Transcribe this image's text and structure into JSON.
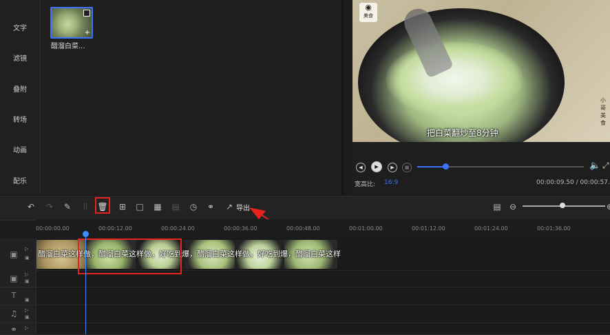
{
  "sidebar": {
    "items": [
      {
        "label": "文字"
      },
      {
        "label": "滤镜"
      },
      {
        "label": "叠附"
      },
      {
        "label": "转场"
      },
      {
        "label": "动画"
      },
      {
        "label": "配乐"
      }
    ]
  },
  "media": {
    "clip_label": "醋溜白菜..."
  },
  "preview": {
    "subtitle": "把白菜翻炒至8分钟",
    "logo_text": "美食",
    "vertical_text": "小哥美食",
    "aspect_label": "宽高比:",
    "aspect_value": "16:9",
    "time": "00:00:09.50 / 00:00:57.7",
    "progress_fraction": 0.17
  },
  "toolbar": {
    "export_label": "导出",
    "delete_tooltip": "删除",
    "zoom_fraction": 0.48
  },
  "timeline": {
    "ruler": [
      "00:00:00.00",
      "00:00:12.00",
      "00:00:24.00",
      "00:00:36.00",
      "00:00:48.00",
      "00:01:00.00",
      "00:01:12.00",
      "00:01:24.00",
      "00:01:36.00"
    ],
    "clip_text": "醋溜白菜这样做，醋溜白菜这样做，好吃到爆，醋溜白菜这样做，好吃到爆，醋溜白菜这样做"
  },
  "colors": {
    "accent": "#3d72ff",
    "highlight": "#e8231f"
  }
}
